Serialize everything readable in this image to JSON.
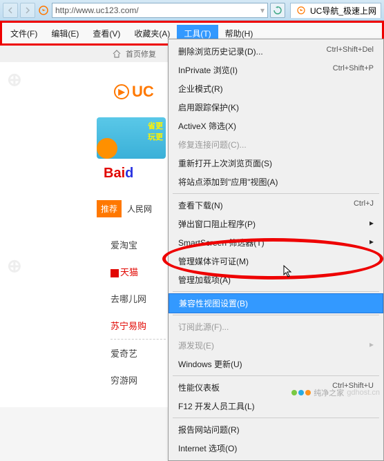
{
  "titlebar": {
    "url": "http://www.uc123.com/",
    "tab_label": "UC导航_极速上网"
  },
  "menubar": {
    "items": [
      {
        "label": "文件(F)"
      },
      {
        "label": "编辑(E)"
      },
      {
        "label": "查看(V)"
      },
      {
        "label": "收藏夹(A)"
      },
      {
        "label": "工具(T)",
        "active": true
      },
      {
        "label": "帮助(H)"
      }
    ]
  },
  "subbar": {
    "text": "首页修复"
  },
  "page": {
    "uc_brand": "UC",
    "banner_line1": "省更",
    "banner_line2": "玩更",
    "baidu_red": "Bai",
    "baidu_blue": "d",
    "tuijian_badge": "推荐",
    "tuijian_text": "人民网",
    "leftcol": [
      {
        "label": "爱淘宝",
        "cls": ""
      },
      {
        "label": "天猫",
        "cls": "tmall",
        "icon": true
      },
      {
        "label": "去哪儿网",
        "cls": ""
      },
      {
        "label": "苏宁易购",
        "cls": "suning"
      },
      {
        "label": "爱奇艺",
        "cls": ""
      },
      {
        "label": "穷游网",
        "cls": ""
      }
    ]
  },
  "dropdown": {
    "items": [
      {
        "label": "删除浏览历史记录(D)...",
        "shortcut": "Ctrl+Shift+Del"
      },
      {
        "label": "InPrivate 浏览(I)",
        "shortcut": "Ctrl+Shift+P"
      },
      {
        "label": "企业模式(R)"
      },
      {
        "label": "启用跟踪保护(K)"
      },
      {
        "label": "ActiveX 筛选(X)"
      },
      {
        "label": "修复连接问题(C)...",
        "disabled": true
      },
      {
        "label": "重新打开上次浏览页面(S)"
      },
      {
        "label": "将站点添加到\"应用\"视图(A)"
      },
      {
        "sep": true
      },
      {
        "label": "查看下载(N)",
        "shortcut": "Ctrl+J"
      },
      {
        "label": "弹出窗口阻止程序(P)",
        "sub": true
      },
      {
        "label": "SmartScreen 筛选器(T)",
        "sub": true
      },
      {
        "label": "管理媒体许可证(M)"
      },
      {
        "label": "管理加载项(A)"
      },
      {
        "sep": true
      },
      {
        "label": "兼容性视图设置(B)",
        "hover": true
      },
      {
        "sep": true
      },
      {
        "label": "订阅此源(F)...",
        "disabled": true
      },
      {
        "label": "源发现(E)",
        "disabled": true,
        "sub": true
      },
      {
        "label": "Windows 更新(U)"
      },
      {
        "sep": true
      },
      {
        "label": "性能仪表板",
        "shortcut": "Ctrl+Shift+U"
      },
      {
        "label": "F12 开发人员工具(L)"
      },
      {
        "sep": true
      },
      {
        "label": "报告网站问题(R)"
      },
      {
        "label": "Internet 选项(O)"
      }
    ]
  },
  "watermark": {
    "brand": "纯净之家",
    "url": "gdhost.cn"
  }
}
